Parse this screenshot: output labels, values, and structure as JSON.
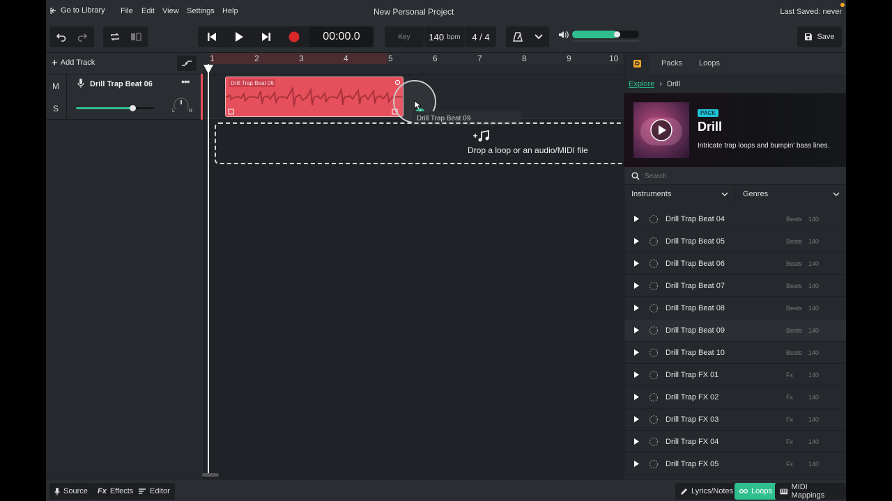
{
  "menubar": {
    "go_to_library": "Go to Library",
    "menus": [
      "File",
      "Edit",
      "View",
      "Settings",
      "Help"
    ],
    "project_title": "New Personal Project",
    "last_saved": "Last Saved: never"
  },
  "toolbar": {
    "time": "00:00.0",
    "key_label": "Key",
    "bpm": "140",
    "bpm_unit": "bpm",
    "time_signature": "4 / 4",
    "volume_level": 0.68,
    "save_label": "Save"
  },
  "tracks": {
    "add_track": "Add Track",
    "mute": "M",
    "solo": "S",
    "track_name": "Drill Trap Beat 06",
    "volume_level": 0.72,
    "pan_left": "L",
    "pan_right": "R"
  },
  "arrangement": {
    "bars": [
      "1",
      "2",
      "3",
      "4",
      "5",
      "6",
      "7",
      "8",
      "9",
      "10"
    ],
    "clip_name": "Drill Trap Beat 06",
    "drag_label": "Drill Trap Beat 09",
    "drop_hint": "Drop a loop or an audio/MIDI file"
  },
  "panel": {
    "tabs": [
      "Packs",
      "Loops"
    ],
    "breadcrumb_root": "Explore",
    "breadcrumb_sep": "›",
    "breadcrumb_current": "Drill",
    "pack_badge": "PACK",
    "pack_title": "Drill",
    "pack_desc": "Intricate trap loops and bumpin' bass lines.",
    "search_placeholder": "Search",
    "filter_instruments": "Instruments",
    "filter_genres": "Genres",
    "loops": [
      {
        "name": "Drill Trap Beat 04",
        "genre": "Beats",
        "bpm": "140"
      },
      {
        "name": "Drill Trap Beat 05",
        "genre": "Beats",
        "bpm": "140"
      },
      {
        "name": "Drill Trap Beat 06",
        "genre": "Beats",
        "bpm": "140"
      },
      {
        "name": "Drill Trap Beat 07",
        "genre": "Beats",
        "bpm": "140"
      },
      {
        "name": "Drill Trap Beat 08",
        "genre": "Beats",
        "bpm": "140"
      },
      {
        "name": "Drill Trap Beat 09",
        "genre": "Beats",
        "bpm": "140"
      },
      {
        "name": "Drill Trap Beat 10",
        "genre": "Beats",
        "bpm": "140"
      },
      {
        "name": "Drill Trap FX 01",
        "genre": "Fx",
        "bpm": "140"
      },
      {
        "name": "Drill Trap FX 02",
        "genre": "Fx",
        "bpm": "140"
      },
      {
        "name": "Drill Trap FX 03",
        "genre": "Fx",
        "bpm": "140"
      },
      {
        "name": "Drill Trap FX 04",
        "genre": "Fx",
        "bpm": "140"
      },
      {
        "name": "Drill Trap FX 05",
        "genre": "Fx",
        "bpm": "140"
      }
    ]
  },
  "statusbar": {
    "source": "Source",
    "effects_prefix": "Fx",
    "effects": "Effects",
    "editor": "Editor",
    "lyrics": "Lyrics/Notes",
    "loops": "Loops",
    "midi": "MIDI Mappings"
  },
  "colors": {
    "accent": "#2fbf8e",
    "clip": "#e5505c",
    "record": "#d62828",
    "badge": "#21c4d9",
    "notification": "#f5a623"
  }
}
